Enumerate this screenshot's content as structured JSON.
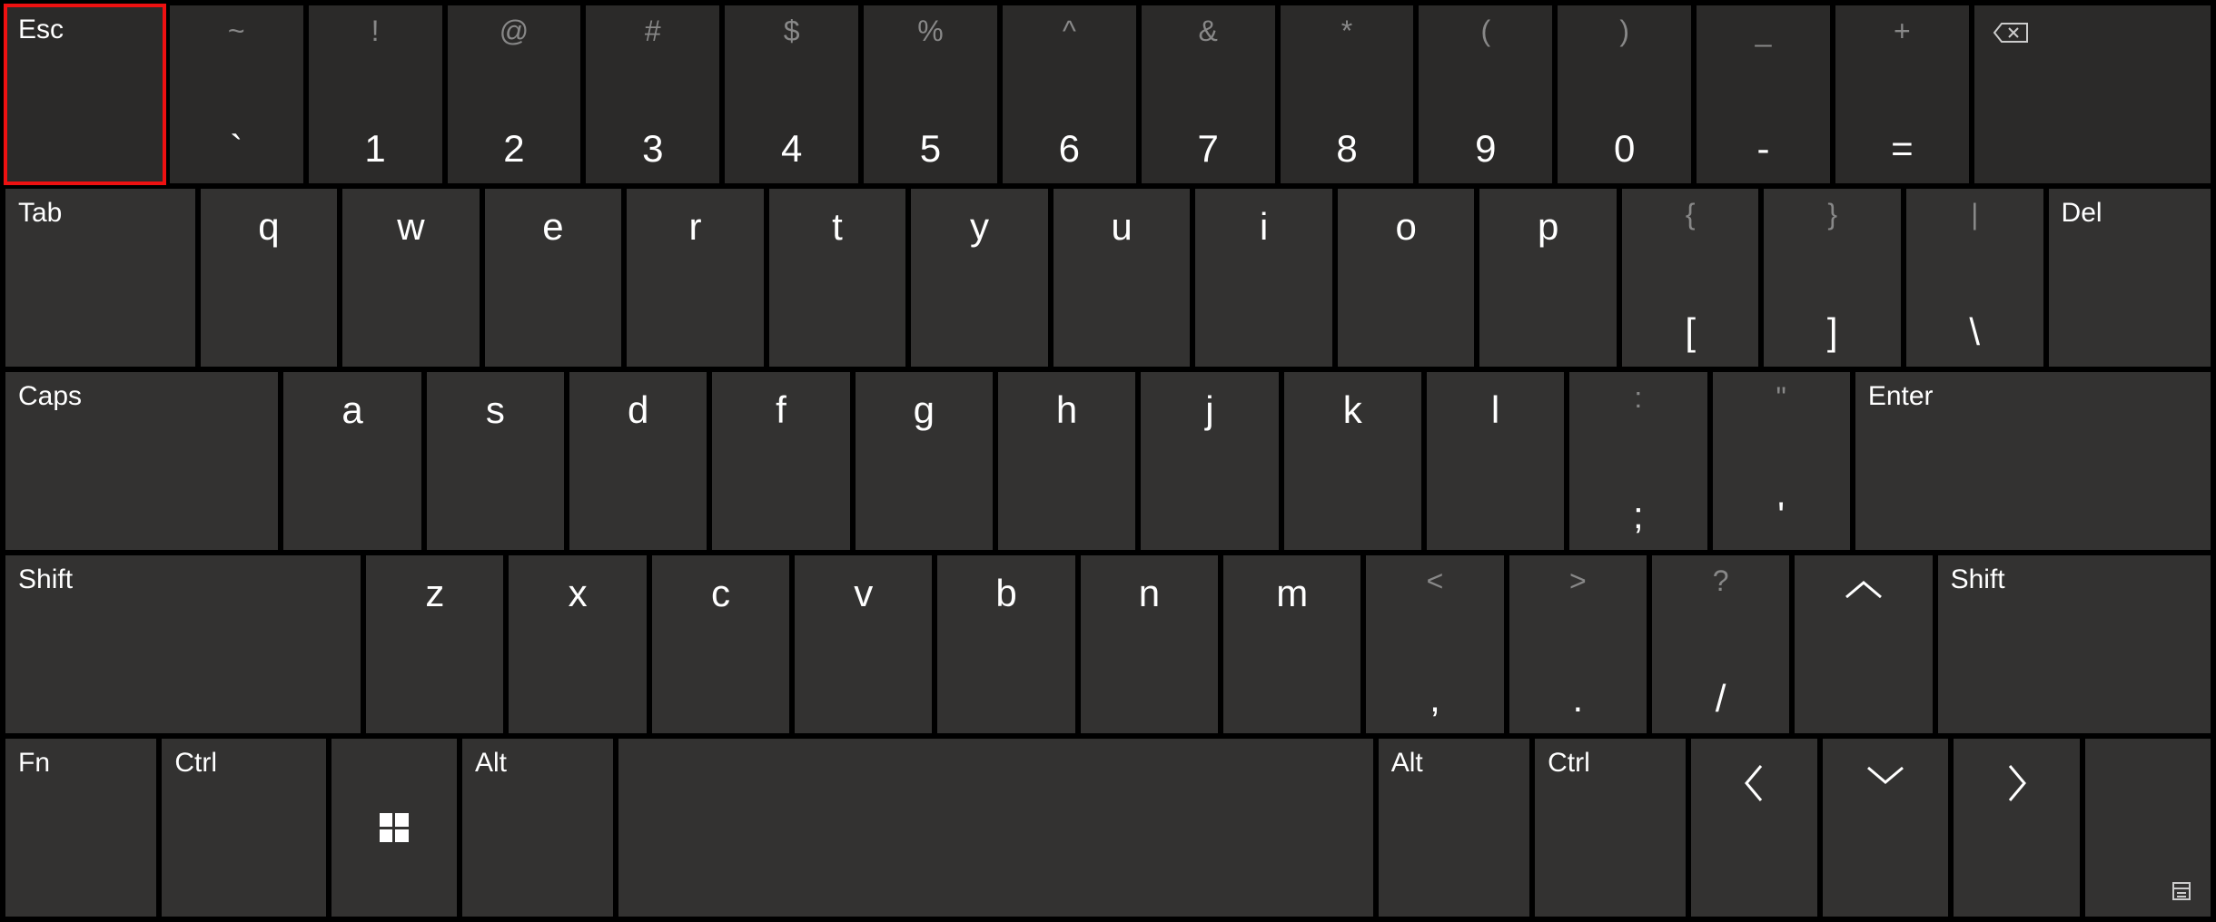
{
  "row1": {
    "esc": "Esc",
    "keys": [
      {
        "u": "~",
        "l": "`"
      },
      {
        "u": "!",
        "l": "1"
      },
      {
        "u": "@",
        "l": "2"
      },
      {
        "u": "#",
        "l": "3"
      },
      {
        "u": "$",
        "l": "4"
      },
      {
        "u": "%",
        "l": "5"
      },
      {
        "u": "^",
        "l": "6"
      },
      {
        "u": "&",
        "l": "7"
      },
      {
        "u": "*",
        "l": "8"
      },
      {
        "u": "(",
        "l": "9"
      },
      {
        "u": ")",
        "l": "0"
      },
      {
        "u": "_",
        "l": "-"
      },
      {
        "u": "+",
        "l": "="
      }
    ],
    "backspace_icon": "backspace"
  },
  "row2": {
    "tab": "Tab",
    "letters": [
      "q",
      "w",
      "e",
      "r",
      "t",
      "y",
      "u",
      "i",
      "o",
      "p"
    ],
    "brackets": [
      {
        "u": "{",
        "l": "["
      },
      {
        "u": "}",
        "l": "]"
      },
      {
        "u": "|",
        "l": "\\"
      }
    ],
    "del": "Del"
  },
  "row3": {
    "caps": "Caps",
    "letters": [
      "a",
      "s",
      "d",
      "f",
      "g",
      "h",
      "j",
      "k",
      "l"
    ],
    "punct": [
      {
        "u": ":",
        "l": ";"
      },
      {
        "u": "\"",
        "l": "'"
      }
    ],
    "enter": "Enter"
  },
  "row4": {
    "shift_l": "Shift",
    "letters": [
      "z",
      "x",
      "c",
      "v",
      "b",
      "n",
      "m"
    ],
    "punct": [
      {
        "u": "<",
        "l": ","
      },
      {
        "u": ">",
        "l": "."
      },
      {
        "u": "?",
        "l": "/"
      }
    ],
    "up_icon": "up",
    "shift_r": "Shift"
  },
  "row5": {
    "fn": "Fn",
    "ctrl_l": "Ctrl",
    "win_icon": "windows",
    "alt_l": "Alt",
    "space": "",
    "alt_r": "Alt",
    "ctrl_r": "Ctrl",
    "left_icon": "left",
    "down_icon": "down",
    "right_icon": "right",
    "options_icon": "options"
  }
}
